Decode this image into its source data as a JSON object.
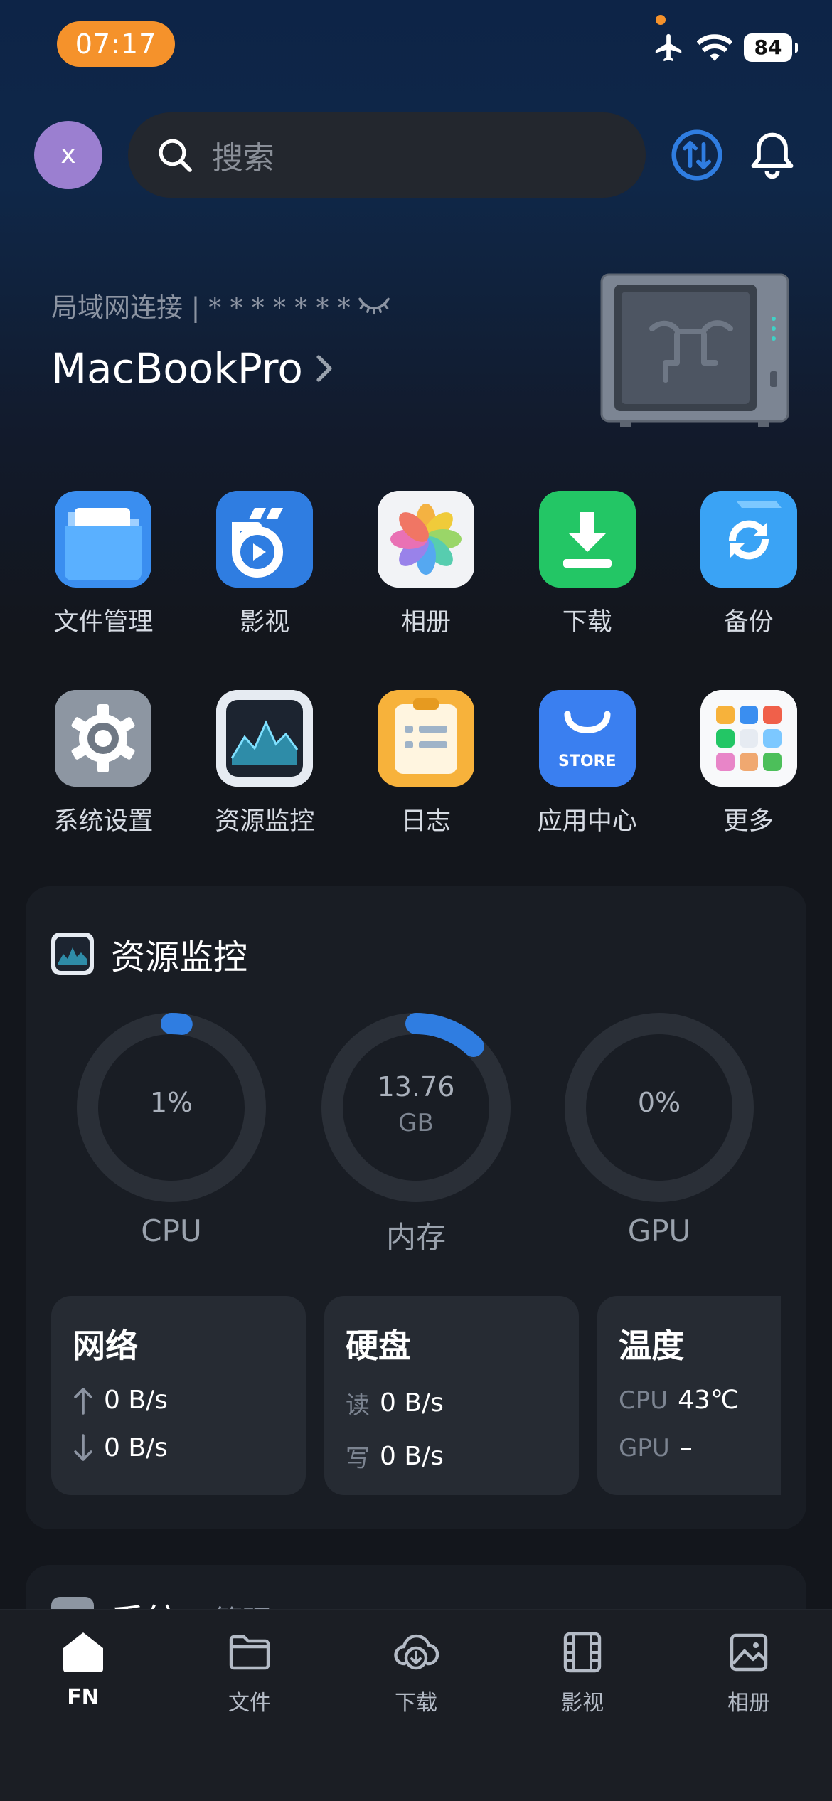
{
  "status": {
    "time": "07:17",
    "battery": "84"
  },
  "header": {
    "avatar_initial": "x",
    "search_placeholder": "搜索"
  },
  "device": {
    "connection_label": "局域网连接 | * * * * * * *",
    "name": "MacBookPro"
  },
  "apps_row1": [
    {
      "label": "文件管理",
      "icon": "folder-icon"
    },
    {
      "label": "影视",
      "icon": "video-icon"
    },
    {
      "label": "相册",
      "icon": "photos-icon"
    },
    {
      "label": "下载",
      "icon": "download-icon"
    },
    {
      "label": "备份",
      "icon": "backup-icon"
    }
  ],
  "apps_row2": [
    {
      "label": "系统设置",
      "icon": "gear-icon"
    },
    {
      "label": "资源监控",
      "icon": "monitor-icon"
    },
    {
      "label": "日志",
      "icon": "log-icon"
    },
    {
      "label": "应用中心",
      "icon": "store-icon"
    },
    {
      "label": "更多",
      "icon": "more-icon"
    }
  ],
  "store_text": "STORE",
  "resource": {
    "title": "资源监控",
    "cpu": {
      "value": "1%",
      "name": "CPU",
      "fraction": 0.01
    },
    "memory": {
      "value": "13.76",
      "unit": "GB",
      "name": "内存",
      "fraction": 0.12
    },
    "gpu": {
      "value": "0%",
      "name": "GPU",
      "fraction": 0.0
    },
    "network": {
      "title": "网络",
      "up": "0 B/s",
      "down": "0 B/s"
    },
    "disk": {
      "title": "硬盘",
      "read_label": "读",
      "read": "0 B/s",
      "write_label": "写",
      "write": "0 B/s"
    },
    "temperature": {
      "title": "温度",
      "cpu_label": "CPU",
      "cpu": "43℃",
      "gpu_label": "GPU",
      "gpu": "–"
    }
  },
  "system_card": {
    "title": "系统",
    "subtitle": "· 管理"
  },
  "tabs": [
    {
      "label": "FN",
      "active": true
    },
    {
      "label": "文件",
      "active": false
    },
    {
      "label": "下载",
      "active": false
    },
    {
      "label": "影视",
      "active": false
    },
    {
      "label": "相册",
      "active": false
    }
  ],
  "colors": {
    "accent": "#2f7de1",
    "time_pill": "#f5922b",
    "avatar": "#9b7fd0"
  }
}
